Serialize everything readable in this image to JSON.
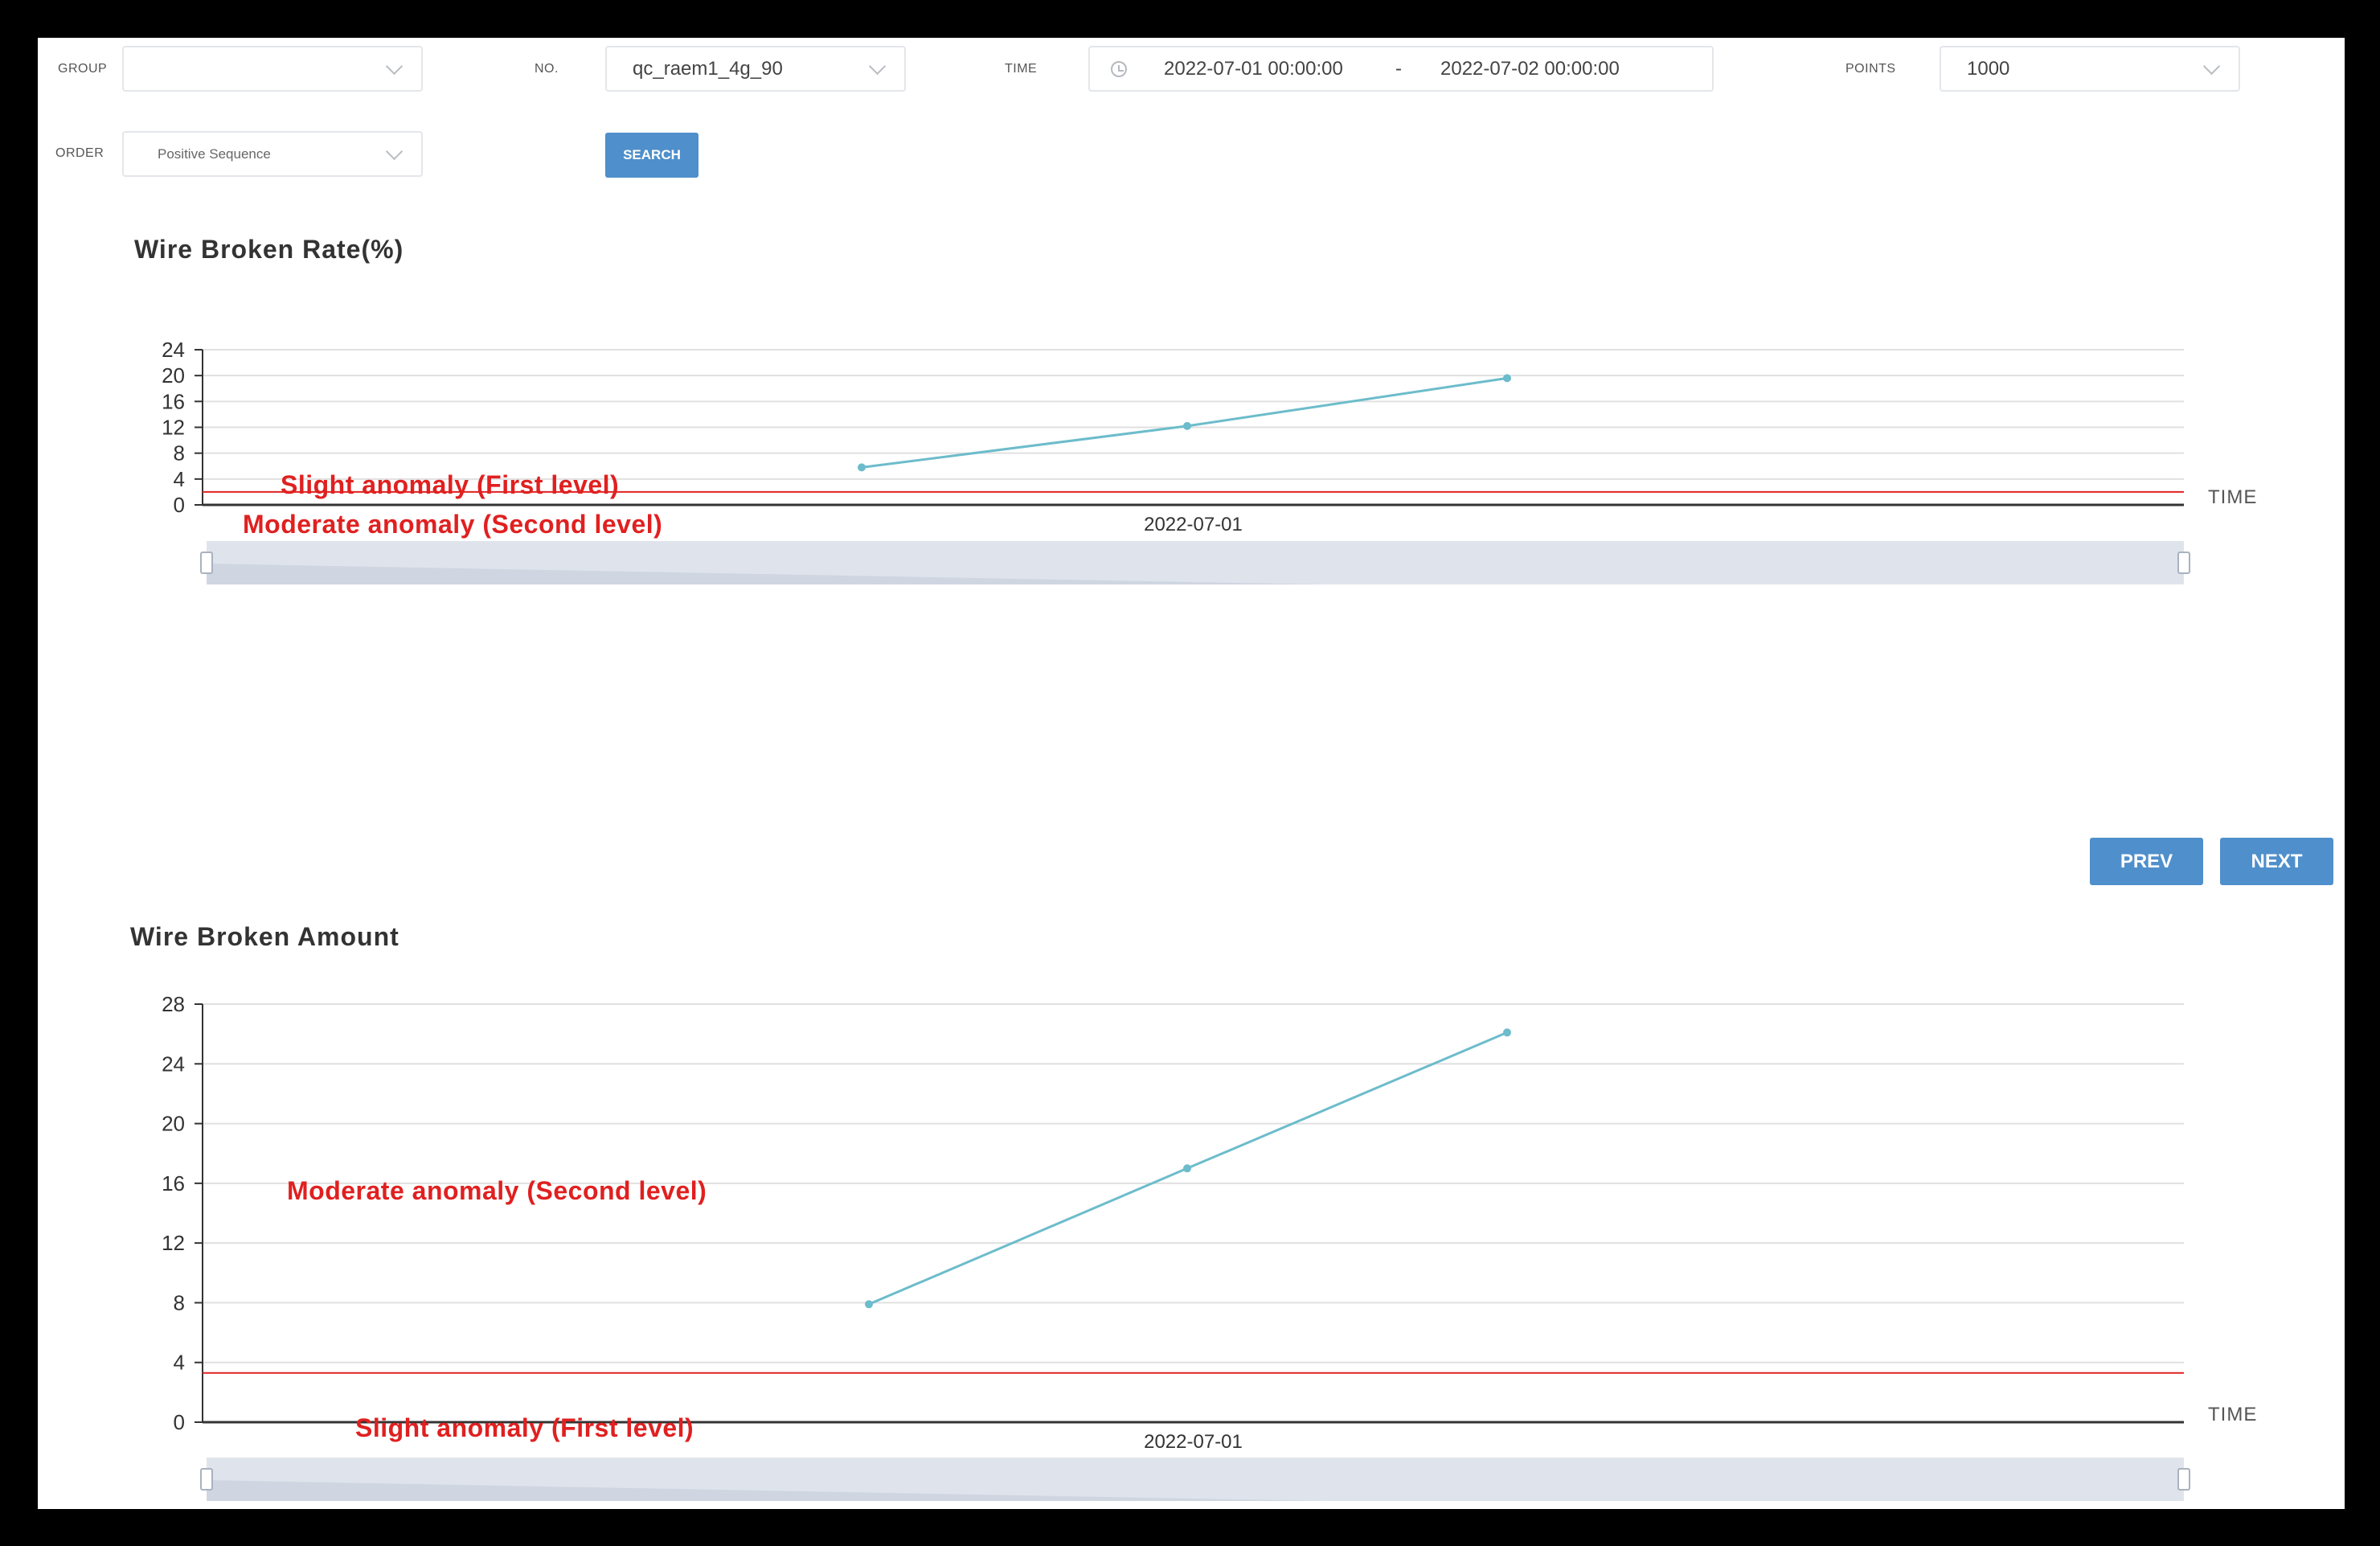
{
  "filters": {
    "group": {
      "label": "GROUP",
      "value": ""
    },
    "number": {
      "label": "NO.",
      "value": "qc_raem1_4g_90"
    },
    "time": {
      "label": "TIME",
      "start": "2022-07-01 00:00:00",
      "separator": "-",
      "end": "2022-07-02 00:00:00"
    },
    "points": {
      "label": "POINTS",
      "value": "1000"
    },
    "order": {
      "label": "ORDER",
      "value": "Positive Sequence"
    },
    "search_label": "SEARCH"
  },
  "pager": {
    "prev_label": "PREV",
    "next_label": "NEXT"
  },
  "colors": {
    "line": "#6cbccb",
    "threshold": "#e02020",
    "button": "#4f8fcb",
    "grid": "#e0e0e0"
  },
  "chart_data": [
    {
      "type": "line",
      "title": "Wire Broken Rate(%)",
      "xlabel": "TIME",
      "ylabel": "",
      "x_tick": "2022-07-01",
      "ylim": [
        0,
        24
      ],
      "yticks": [
        0,
        4,
        8,
        12,
        16,
        20,
        24
      ],
      "series": [
        {
          "values": [
            5.8,
            12.2,
            19.6
          ]
        }
      ],
      "threshold": 2,
      "annotations": {
        "second_level": "Moderate anomaly (Second level)",
        "first_level": "Slight anomaly (First level)"
      },
      "grid": true
    },
    {
      "type": "line",
      "title": "Wire Broken Amount",
      "xlabel": "TIME",
      "ylabel": "",
      "x_tick": "2022-07-01",
      "ylim": [
        0,
        28
      ],
      "yticks": [
        0,
        4,
        8,
        12,
        16,
        20,
        24,
        28
      ],
      "series": [
        {
          "values": [
            7.9,
            17.0,
            26.1
          ]
        }
      ],
      "threshold": 3.3,
      "annotations": {
        "second_level": "Moderate anomaly (Second level)",
        "first_level": "Slight anomaly (First level)"
      },
      "grid": true
    }
  ]
}
